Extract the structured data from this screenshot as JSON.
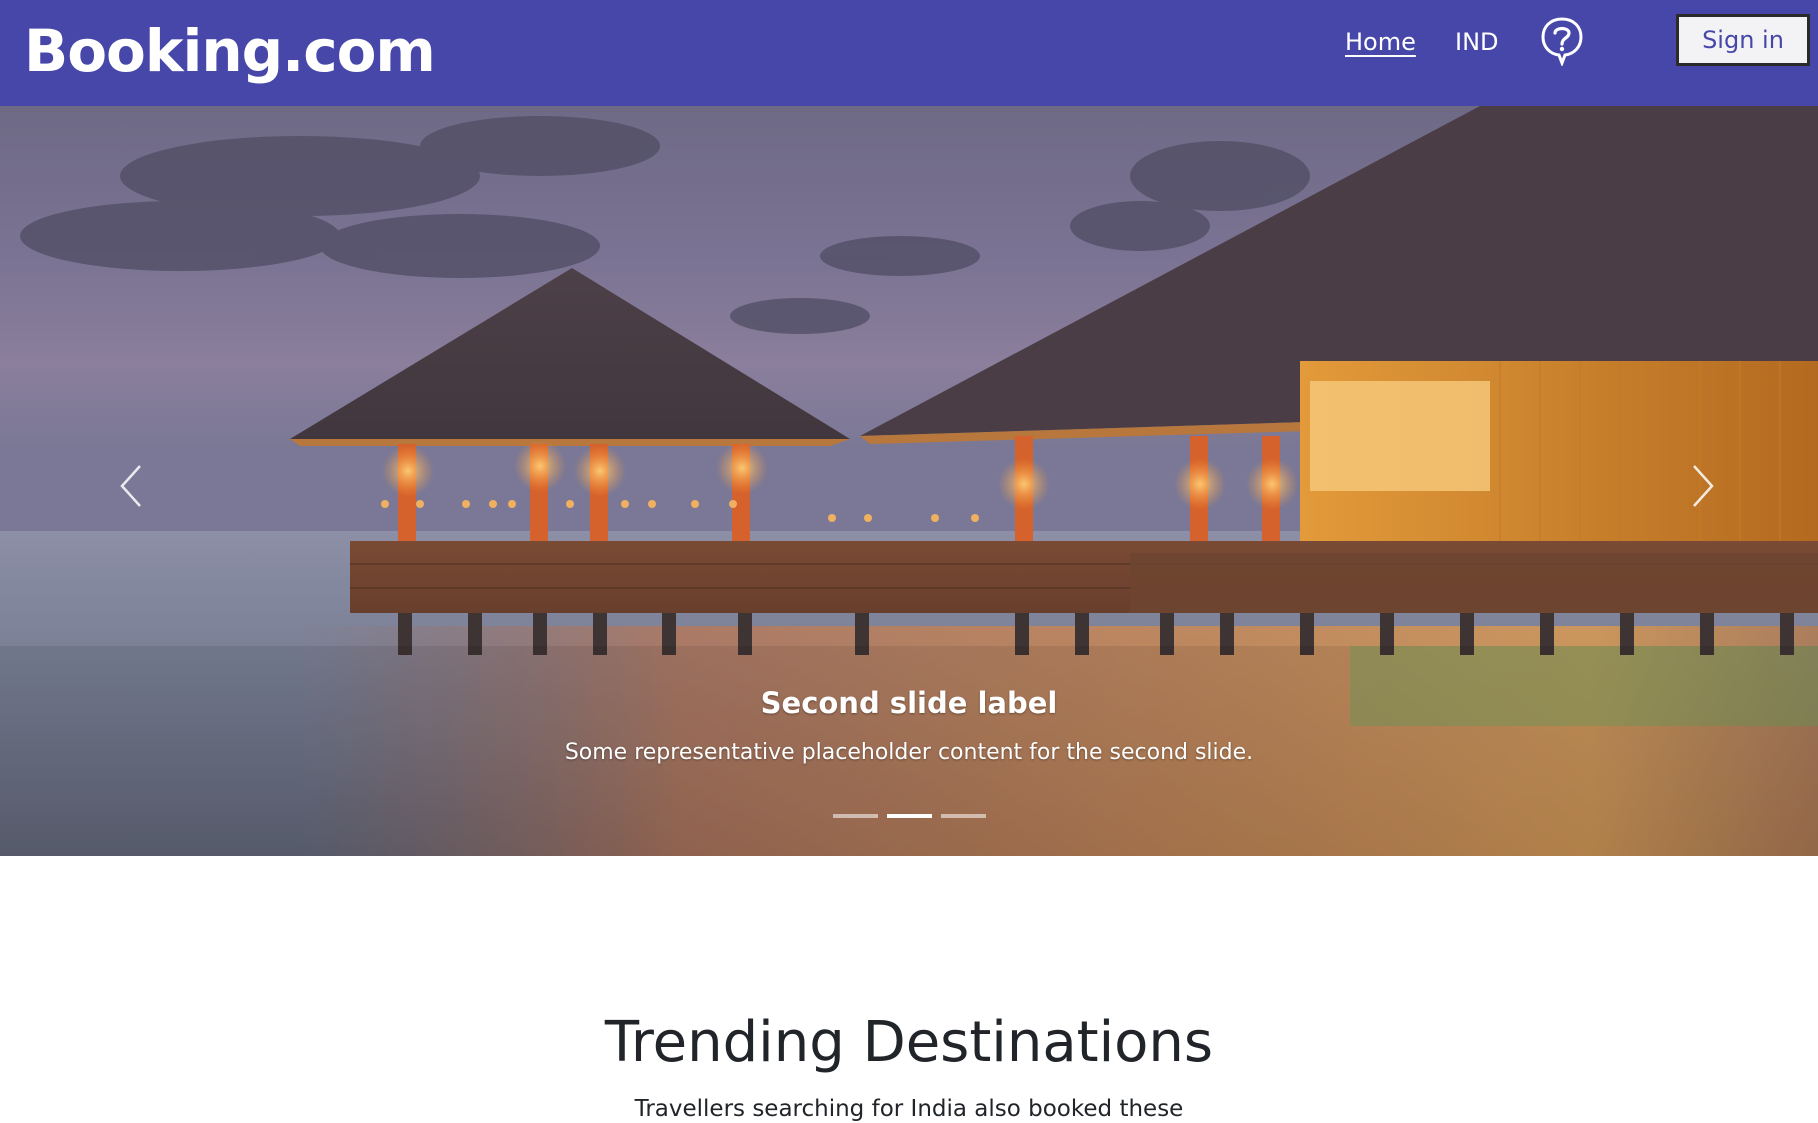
{
  "navbar": {
    "brand": "Booking.com",
    "links": [
      {
        "label": "Home"
      },
      {
        "label": "IND"
      }
    ],
    "help_icon": "question-circle-icon",
    "sign_in_label": "Sign in",
    "background_color": "#4747aa"
  },
  "carousel": {
    "prev_icon": "chevron-left-icon",
    "next_icon": "chevron-right-icon",
    "active_slide": 2,
    "slide_count": 3,
    "slide": {
      "title": "Second slide label",
      "text": "Some representative placeholder content for the second slide."
    }
  },
  "trending": {
    "title": "Trending Destinations",
    "subtitle": "Travellers searching for India also booked these"
  }
}
